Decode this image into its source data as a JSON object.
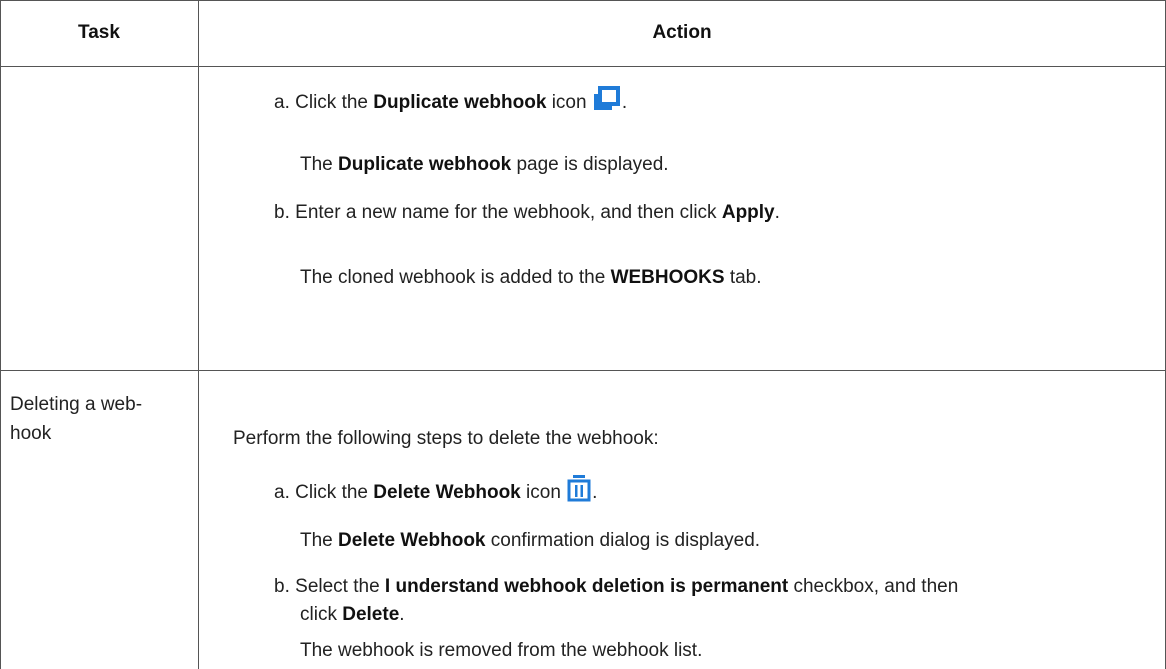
{
  "headers": {
    "task": "Task",
    "action": "Action"
  },
  "row1": {
    "step_a": {
      "marker": "a.",
      "text1": "Click the ",
      "bold1": "Duplicate webhook",
      "text2": " icon ",
      "icon": "duplicate-icon",
      "end": "."
    },
    "result_a": {
      "text1": "The ",
      "bold1": "Duplicate webhook",
      "text2": " page is displayed."
    },
    "step_b": {
      "marker": "b.",
      "text1": "Enter a new name for the webhook, and then click ",
      "bold1": "Apply",
      "end": "."
    },
    "result_b": {
      "text1": "The cloned webhook is added to the ",
      "bold1": "WEBHOOKS",
      "text2": " tab."
    }
  },
  "row2": {
    "task_line1": "Deleting a web-",
    "task_line2": "hook",
    "intro": "Perform the following steps to delete the webhook:",
    "step_a": {
      "marker": "a.",
      "text1": "Click the ",
      "bold1": "Delete Webhook",
      "text2": " icon ",
      "icon": "trash-icon",
      "end": "."
    },
    "result_a": {
      "text1": "The ",
      "bold1": "Delete Webhook",
      "text2": " confirmation dialog is displayed."
    },
    "step_b": {
      "marker": "b.",
      "text1": "Select the ",
      "bold1": "I understand webhook deletion is permanent",
      "text2": " checkbox, and then"
    },
    "step_b_cont": {
      "text1": "click ",
      "bold1": "Delete",
      "end": "."
    },
    "result_b": "The webhook is removed from the webhook list."
  },
  "colors": {
    "icon_blue": "#1f7bd8",
    "border": "#555555"
  }
}
